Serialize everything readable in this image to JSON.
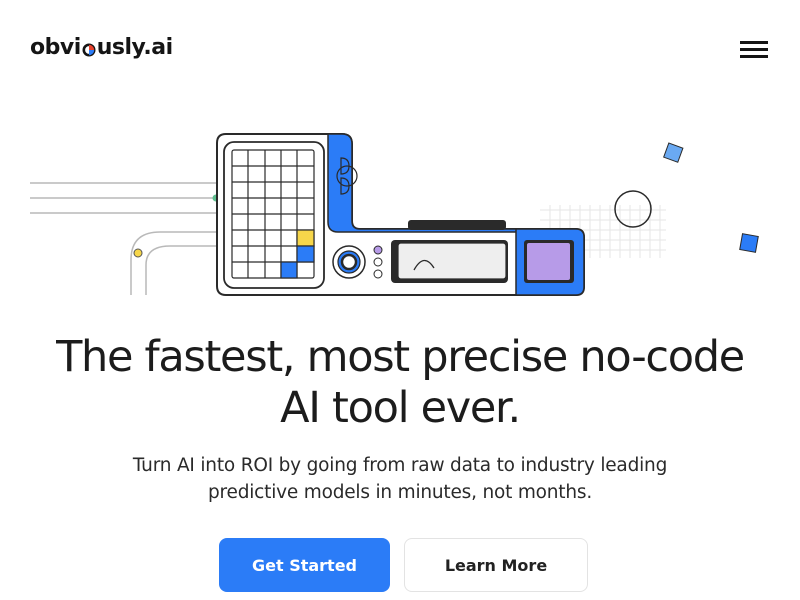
{
  "header": {
    "logo_prefix": "obvi",
    "logo_suffix": "usly.ai",
    "menu_icon": "hamburger-menu-icon"
  },
  "hero": {
    "headline": "The fastest, most precise no-code AI tool ever.",
    "subheadline": "Turn AI into ROI by going from raw data to industry leading predictive models in minutes, not months."
  },
  "actions": {
    "primary_label": "Get Started",
    "secondary_label": "Learn More"
  },
  "colors": {
    "brand_blue": "#2b7cf7",
    "accent_yellow": "#f6d64a",
    "accent_purple": "#b79be8",
    "logo_red": "#e8412c",
    "text_dark": "#1c1c1c"
  }
}
